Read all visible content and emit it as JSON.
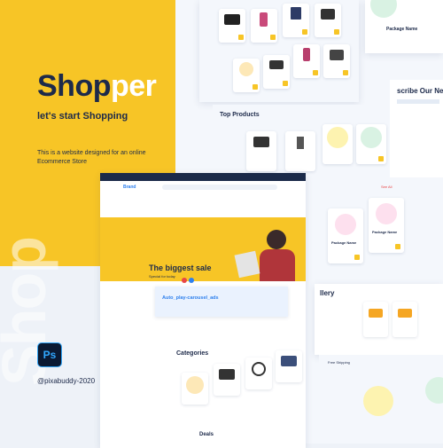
{
  "cover": {
    "brand_part1": "Shop",
    "brand_part2": "per",
    "tagline": "let's start Shopping",
    "description": "This is a website designed for an online Ecommerce Store",
    "ps_label": "Ps",
    "credit": "@pixabuddy-2020",
    "watermark": "Shop"
  },
  "mockups": {
    "top_products": "Top Products",
    "subscribe": "scribe Our New",
    "hero_title": "The biggest sale",
    "hero_sub": "Special for today",
    "auto_play": "Auto_play-carousel_ads",
    "categories": "Categories",
    "gallery": "llery",
    "deals": "Deals",
    "site_brand": "Brand",
    "product_name_1": "Package Name",
    "product_name_2": "Package Name",
    "see_all": "See All",
    "free_shipping": "Free Shipping"
  },
  "colors": {
    "yellow": "#f7c526",
    "navy": "#1d2a4a",
    "accent_blue": "#2f80ed",
    "red": "#e84646"
  }
}
